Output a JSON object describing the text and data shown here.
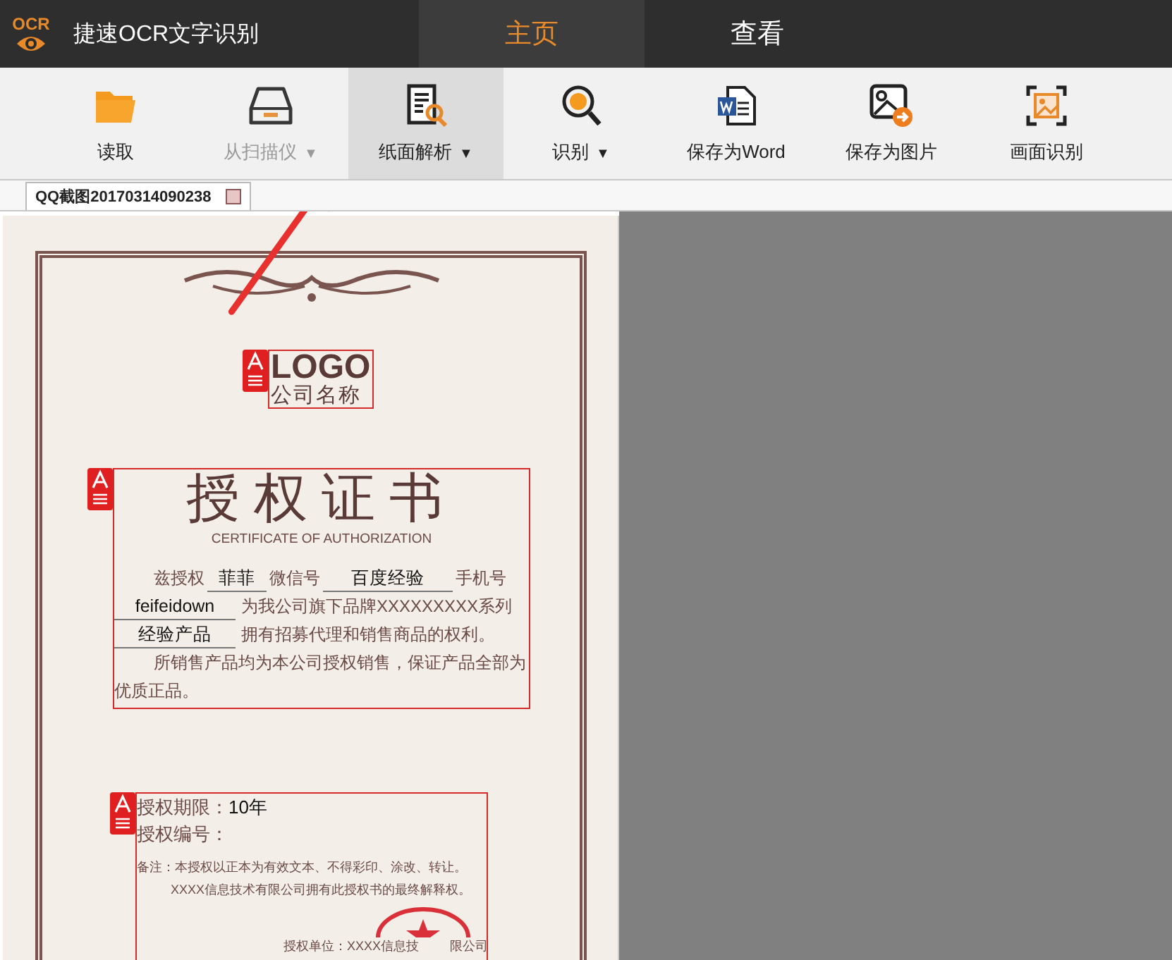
{
  "app": {
    "logo_text": "OCR",
    "title": "捷速OCR文字识别"
  },
  "nav_tabs": [
    {
      "label": "主页",
      "selected": true
    },
    {
      "label": "查看",
      "selected": false
    }
  ],
  "toolbar": [
    {
      "kind": "folder",
      "label": "读取",
      "disabled": false,
      "selected": false
    },
    {
      "kind": "scanner",
      "label": "从扫描仪",
      "caret": "▼",
      "disabled": true,
      "selected": false
    },
    {
      "kind": "page-search",
      "label": "纸面解析",
      "caret": "▼",
      "disabled": false,
      "selected": true
    },
    {
      "kind": "letter-search",
      "label": "识别",
      "caret": "▼",
      "disabled": false,
      "selected": false
    },
    {
      "kind": "word",
      "label": "保存为Word",
      "disabled": false,
      "selected": false
    },
    {
      "kind": "image-export",
      "label": "保存为图片",
      "disabled": false,
      "selected": false
    },
    {
      "kind": "capture",
      "label": "画面识别",
      "disabled": false,
      "selected": false
    }
  ],
  "document_tabs": [
    {
      "label": "QQ截图20170314090238",
      "selected": true
    }
  ],
  "certificate": {
    "logo": "LOGO",
    "company": "公司名称",
    "title": "授权证书",
    "subtitle": "CERTIFICATE OF AUTHORIZATION",
    "lines": [
      [
        {
          "kind": "text",
          "text": "兹授权"
        },
        {
          "kind": "fill",
          "text": "菲菲"
        },
        {
          "kind": "text",
          "text": "微信号"
        },
        {
          "kind": "fill",
          "text": "百度经验"
        },
        {
          "kind": "text",
          "text": "手机号"
        }
      ],
      [
        {
          "kind": "fill",
          "text": "feifeidown"
        },
        {
          "kind": "text",
          "text": "为我公司旗下品牌XXXXXXXXX系列"
        }
      ],
      [
        {
          "kind": "fill",
          "text": "经验产品"
        },
        {
          "kind": "text",
          "text": "拥有招募代理和销售商品的权利。"
        }
      ]
    ],
    "paragraph": "所销售产品均为本公司授权销售，保证产品全部为优质正品。",
    "term_label": "授权期限：",
    "term_value": "10年",
    "number_label": "授权编号：",
    "notes": [
      "备注：本授权以正本为有效文本、不得彩印、涂改、转让。",
      "XXXX信息技术有限公司拥有此授权书的最终解释权。"
    ],
    "issuer_parts": [
      "授权单位：XXXX信息技",
      "限公司"
    ]
  }
}
